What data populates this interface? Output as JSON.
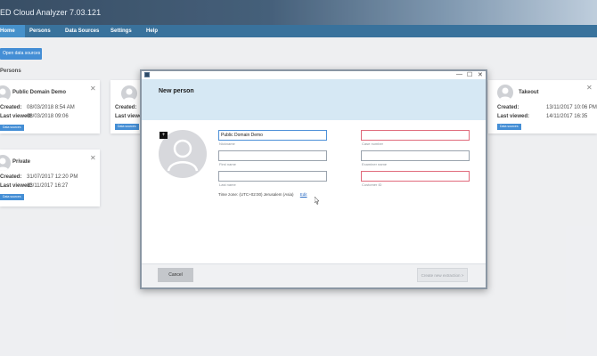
{
  "app": {
    "title": "ED Cloud Analyzer 7.03.121"
  },
  "nav": {
    "tabs": [
      {
        "label": "Home"
      },
      {
        "label": "Persons"
      },
      {
        "label": "Data Sources"
      },
      {
        "label": "Settings"
      },
      {
        "label": "Help"
      }
    ]
  },
  "home": {
    "open_button": "Open data sources",
    "section_label": "Persons"
  },
  "cards": [
    {
      "name": "Public Domain Demo",
      "created_label": "Created:",
      "created": "08/03/2018 8:54 AM",
      "viewed_label": "Last viewed:",
      "viewed": "08/03/2018 09:06",
      "button": "Data sources"
    },
    {
      "name": "Private",
      "created_label": "Created:",
      "created": "31/07/2017 12:20 PM",
      "viewed_label": "Last viewed:",
      "viewed": "13/11/2017 16:27",
      "button": "Data sources"
    },
    {
      "name": "P",
      "created_label": "Created:",
      "viewed_label": "Last viewed:",
      "button": "Data sources"
    },
    {
      "name": "Takeout",
      "created_label": "Created:",
      "created": "13/11/2017 10:06 PM",
      "viewed_label": "Last viewed:",
      "viewed": "14/11/2017 16:35",
      "button": "Data sources"
    }
  ],
  "modal": {
    "title": "New person",
    "controls": {
      "minimize": "—",
      "maximize": "☐",
      "close": "✕"
    },
    "photo_button": "+",
    "fields": {
      "nickname": {
        "value": "Public Domain Demo",
        "caption": "Nickname"
      },
      "first_name": {
        "value": "",
        "caption": "First name"
      },
      "last_name": {
        "value": "",
        "caption": "Last name"
      },
      "case_number": {
        "value": "",
        "caption": "Case number"
      },
      "examiner_name": {
        "value": "",
        "caption": "Examiner name"
      },
      "customer_id": {
        "value": "",
        "caption": "Customer ID"
      }
    },
    "timezone": {
      "label": "Time zone:",
      "value": "(UTC+02:00)  Jerusalem  (Asia)",
      "edit": "Edit"
    },
    "cancel": "Cancel",
    "create": "Create new extraction >"
  },
  "colors": {
    "accent": "#2b7fd0",
    "nav": "#1e5f8f",
    "error_border": "#e06b7c",
    "modal_header": "#d6e8f4"
  }
}
